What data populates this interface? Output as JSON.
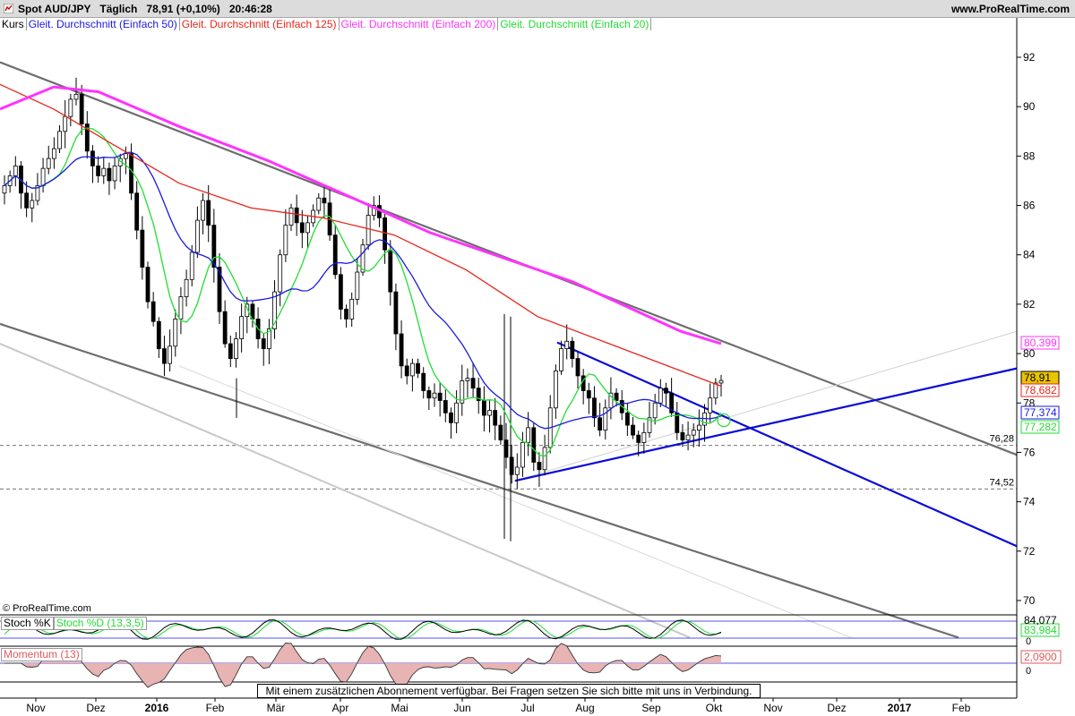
{
  "header": {
    "symbol": "Spot AUD/JPY",
    "period": "Täglich",
    "last": "78,91 (+0,10%)",
    "time": "20:46:28",
    "site": "www.ProRealTime.com"
  },
  "legend": {
    "price": "Kurs",
    "ma50": "Gleit. Durchschnitt (Einfach 50)",
    "ma125": "Gleit. Durchschnitt (Einfach 125)",
    "ma200": "Gleit. Durchschnitt (Einfach 200)",
    "ma20": "Gleit. Durchschnitt (Einfach 20)"
  },
  "colors": {
    "ma50": "#1a1adf",
    "ma125": "#e8251b",
    "ma200": "#ff33ff",
    "ma20": "#22dd33",
    "trend_gray": "#6e6e6e",
    "trend_light": "#c8c8c8",
    "triangle": "#0a0ad8",
    "last_price_box": "#e8c400"
  },
  "copyright": "© ProRealTime.com",
  "notice": "Mit einem zusätzlichen Abonnement verfügbar. Bei Fragen setzen Sie sich bitte mit uns in Verbindung.",
  "stoch": {
    "k_label": "Stoch %K",
    "d_label": "Stoch %D (13,3,5)",
    "value_k": "84,077",
    "value_d": "83,984",
    "axis_zero": "0"
  },
  "momentum": {
    "label": "Momentum (13)",
    "value": "2,0900",
    "axis_zero": "0"
  },
  "chart_data": {
    "type": "candlestick",
    "title": "Spot AUD/JPY",
    "y_ticks": [
      70,
      72,
      74,
      76,
      78,
      80,
      82,
      84,
      86,
      88,
      90,
      92
    ],
    "ylim": [
      68.5,
      93.6
    ],
    "x_ticks": [
      {
        "label": "Nov",
        "bold": false
      },
      {
        "label": "Dez",
        "bold": false
      },
      {
        "label": "2016",
        "bold": true
      },
      {
        "label": "Feb",
        "bold": false
      },
      {
        "label": "Mär",
        "bold": false
      },
      {
        "label": "Apr",
        "bold": false
      },
      {
        "label": "Mai",
        "bold": false
      },
      {
        "label": "Jun",
        "bold": false
      },
      {
        "label": "Jul",
        "bold": false
      },
      {
        "label": "Aug",
        "bold": false
      },
      {
        "label": "Sep",
        "bold": false
      },
      {
        "label": "Okt",
        "bold": false
      },
      {
        "label": "Nov",
        "bold": false
      },
      {
        "label": "Dez",
        "bold": false
      },
      {
        "label": "2017",
        "bold": true
      },
      {
        "label": "Feb",
        "bold": false
      }
    ],
    "horizontal_levels": [
      {
        "value": 76.28,
        "label": "76,28"
      },
      {
        "value": 74.52,
        "label": "74,52"
      }
    ],
    "price_tags": [
      {
        "value": 80.399,
        "label": "80,399",
        "series": "ma200"
      },
      {
        "value": 78.91,
        "label": "78,91",
        "series": "last"
      },
      {
        "value": 78.682,
        "label": "78,682",
        "series": "ma125"
      },
      {
        "value": 77.374,
        "label": "77,374",
        "series": "ma50"
      },
      {
        "value": 77.282,
        "label": "77,282",
        "series": "ma20"
      }
    ],
    "ohlc_closes": [
      86.8,
      87.2,
      87.6,
      86.5,
      85.9,
      86.2,
      86.8,
      87.5,
      87.9,
      88.3,
      89.0,
      89.6,
      90.3,
      90.5,
      89.3,
      88.2,
      87.6,
      87.2,
      87.5,
      87.0,
      87.6,
      87.9,
      88.1,
      86.5,
      85.0,
      83.5,
      82.1,
      81.3,
      80.2,
      79.6,
      80.3,
      81.4,
      82.3,
      83.0,
      84.1,
      85.4,
      86.2,
      85.2,
      83.5,
      81.7,
      80.4,
      79.8,
      80.6,
      81.5,
      82.0,
      81.4,
      80.6,
      80.2,
      81.0,
      82.5,
      84.0,
      85.2,
      85.9,
      85.3,
      84.9,
      85.3,
      85.8,
      86.3,
      86.1,
      84.8,
      83.2,
      81.8,
      81.4,
      82.2,
      83.3,
      84.4,
      85.6,
      86.0,
      85.5,
      84.2,
      82.5,
      80.8,
      79.5,
      79.1,
      79.6,
      79.2,
      78.5,
      78.2,
      78.4,
      78.1,
      77.6,
      77.2,
      78.0,
      78.9,
      79.0,
      78.6,
      78.1,
      77.5,
      77.7,
      77.1,
      76.5,
      75.8,
      75.1,
      75.4,
      76.4,
      77.0,
      75.6,
      75.3,
      76.2,
      77.8,
      79.3,
      80.2,
      80.5,
      79.8,
      79.1,
      78.5,
      78.2,
      77.4,
      76.9,
      77.8,
      78.4,
      78.1,
      77.6,
      77.1,
      76.7,
      76.4,
      76.8,
      77.4,
      78.0,
      78.6,
      78.4,
      77.6,
      76.8,
      76.5,
      76.7,
      76.9,
      77.1,
      77.6,
      78.2,
      78.81,
      78.91
    ]
  }
}
